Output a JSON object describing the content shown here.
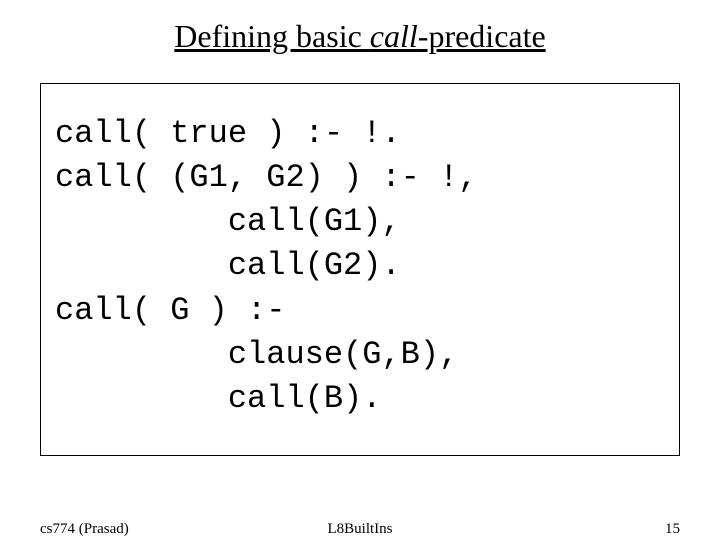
{
  "title": {
    "prefix": "Defining basic ",
    "ital": "call",
    "suffix": "-predicate"
  },
  "code": {
    "l1": "call( true ) :- !.",
    "l2": "call( (G1, G2) ) :- !,",
    "l3": "         call(G1),",
    "l4": "         call(G2).",
    "l5": "call( G ) :-",
    "l6": "         clause(G,B),",
    "l7": "         call(B)."
  },
  "footer": {
    "left": "cs774 (Prasad)",
    "center": "L8BuiltIns",
    "right": "15"
  }
}
